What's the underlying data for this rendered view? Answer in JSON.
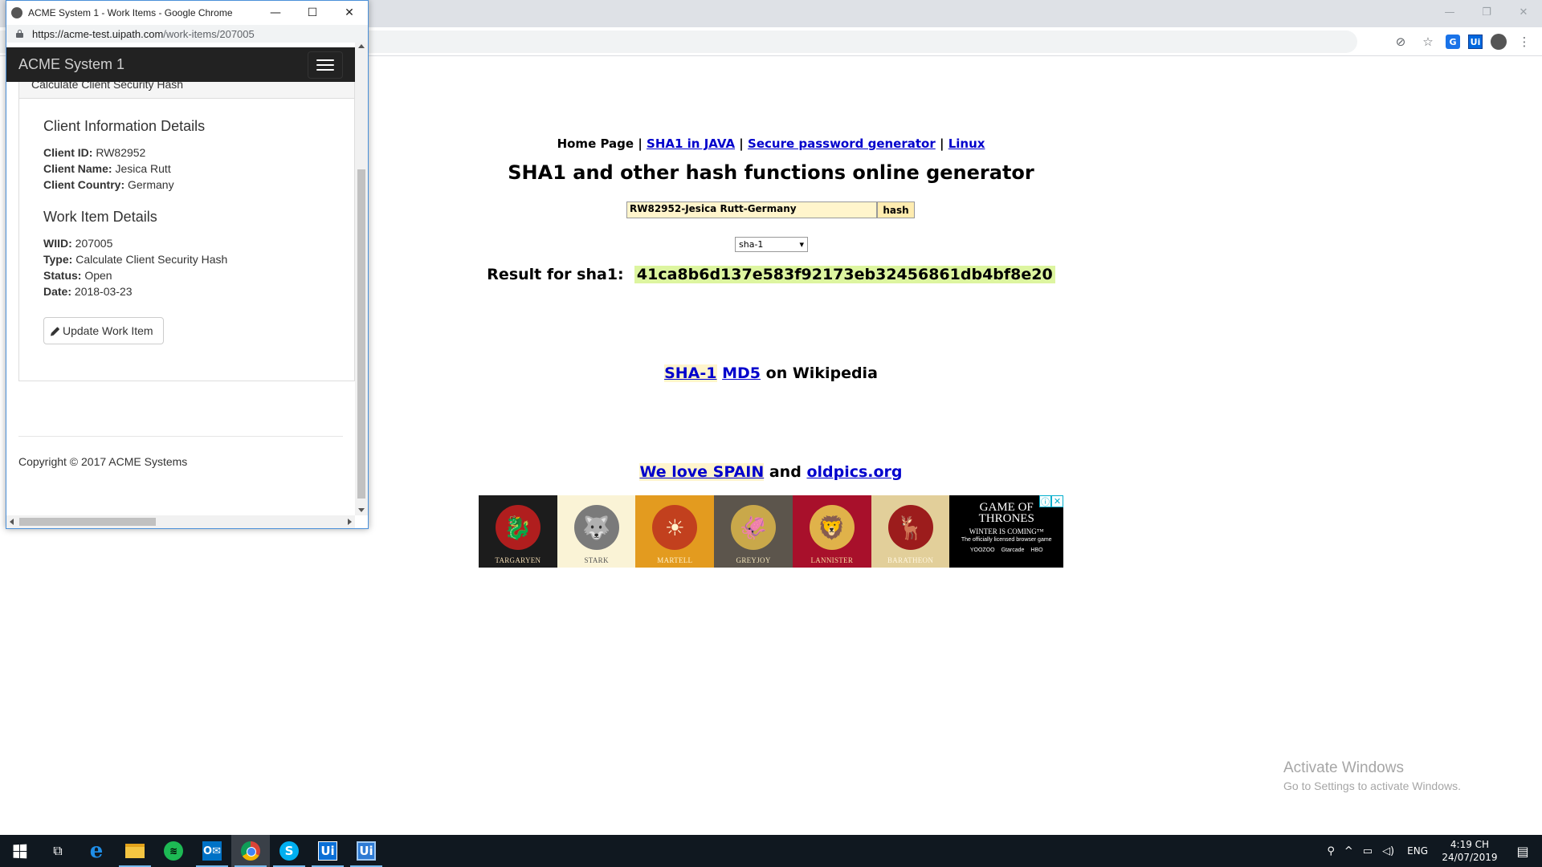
{
  "background_browser": {
    "window_controls": {
      "minimize": "—",
      "restore": "❐",
      "close": "✕"
    },
    "toolbar_icons": [
      "extension-icon",
      "star-icon",
      "translate-icon",
      "uipath-extension-icon",
      "profile-avatar-icon",
      "menu-icon"
    ],
    "toolbar_icon_glyphs": {
      "star": "☆",
      "translate": "G",
      "uipath": "Ui",
      "menu": "⋮",
      "extension": "⊘"
    }
  },
  "sha_page": {
    "nav": {
      "home": "Home Page",
      "sep": " | ",
      "sha1_java": "SHA1 in JAVA",
      "password_gen": "Secure password generator",
      "linux": "Linux"
    },
    "title": "SHA1 and other hash functions online generator",
    "input_value": "RW82952-Jesica Rutt-Germany",
    "hash_button": "hash",
    "algorithm": "sha-1",
    "algorithm_arrow": "▾",
    "result_label": "Result for sha1:",
    "result_hash": "41ca8b6d137e583f92173eb32456861db4bf8e20",
    "wiki": {
      "sha1": "SHA-1",
      "md5": "MD5",
      "suffix": "on Wikipedia"
    },
    "spain": {
      "love": "We love SPAIN",
      "and": "and",
      "oldpics": "oldpics.org"
    },
    "ad": {
      "houses": [
        {
          "name": "TARGARYEN",
          "bg": "#1c1c1c",
          "sigil_color": "#b01e1e",
          "text_color": "#f0d9b0",
          "glyph": "🐉"
        },
        {
          "name": "STARK",
          "bg": "#faf3d6",
          "sigil_color": "#7a7a7a",
          "text_color": "#555555",
          "glyph": "🐺"
        },
        {
          "name": "MARTELL",
          "bg": "#e39b1f",
          "sigil_color": "#c2401e",
          "text_color": "#fff2cc",
          "glyph": "☀"
        },
        {
          "name": "GREYJOY",
          "bg": "#5c554c",
          "sigil_color": "#c9a84a",
          "text_color": "#f0e2b8",
          "glyph": "🦑"
        },
        {
          "name": "LANNISTER",
          "bg": "#a8102b",
          "sigil_color": "#e0b24a",
          "text_color": "#f6dca0",
          "glyph": "🦁"
        },
        {
          "name": "BARATHEON",
          "bg": "#e2cf9a",
          "sigil_color": "#9c1c1c",
          "text_color": "#fff7e0",
          "glyph": "🦌"
        }
      ],
      "got_title_1": "GAME OF",
      "got_title_2": "THRONES",
      "got_sub": "WINTER IS COMING™",
      "got_tag": "The officially licensed browser game",
      "got_logos": [
        "YOOZOO",
        "Gtarcade",
        "HBO"
      ],
      "info_icon": "ⓘ",
      "close_icon": "✕"
    },
    "activate_windows": {
      "title": "Activate Windows",
      "subtitle": "Go to Settings to activate Windows."
    }
  },
  "acme_window": {
    "title": "ACME System 1 - Work Items - Google Chrome",
    "window_controls": {
      "minimize": "—",
      "maximize": "☐",
      "close": "✕"
    },
    "url_host": "https://acme-test.uipath.com",
    "url_path": "/work-items/207005",
    "brand": "ACME System 1",
    "panel_heading": "Calculate Client Security Hash",
    "client_section": "Client Information Details",
    "client": [
      {
        "label": "Client ID:",
        "value": " RW82952"
      },
      {
        "label": "Client Name:",
        "value": " Jesica Rutt"
      },
      {
        "label": "Client Country:",
        "value": " Germany"
      }
    ],
    "work_section": "Work Item Details",
    "work": [
      {
        "label": "WIID:",
        "value": " 207005"
      },
      {
        "label": "Type:",
        "value": " Calculate Client Security Hash"
      },
      {
        "label": "Status:",
        "value": " Open"
      },
      {
        "label": "Date:",
        "value": " 2018-03-23"
      }
    ],
    "update_button": "Update Work Item",
    "footer": "Copyright © 2017 ACME Systems"
  },
  "taskbar": {
    "apps": [
      {
        "name": "task-view-button",
        "icon": "taskview",
        "label": "⧉"
      },
      {
        "name": "edge-button",
        "icon": "edge",
        "label": "e"
      },
      {
        "name": "file-explorer-button",
        "icon": "explorer",
        "label": ""
      },
      {
        "name": "spotify-button",
        "icon": "spotify",
        "label": "≋"
      },
      {
        "name": "outlook-button",
        "icon": "outlook",
        "label": "O✉"
      },
      {
        "name": "chrome-button",
        "icon": "chrome",
        "label": ""
      },
      {
        "name": "skype-button",
        "icon": "skype",
        "label": "S"
      },
      {
        "name": "uipath-studio-button",
        "icon": "ui",
        "label": "Ui"
      },
      {
        "name": "uipath-robot-button",
        "icon": "ui2",
        "label": "Ui"
      }
    ],
    "tray": {
      "people": "⚲",
      "chevron": "^",
      "network": "▭",
      "volume": "◁)",
      "lang": "ENG",
      "time": "4:19 CH",
      "date": "24/07/2019",
      "notifications": "▤"
    }
  }
}
